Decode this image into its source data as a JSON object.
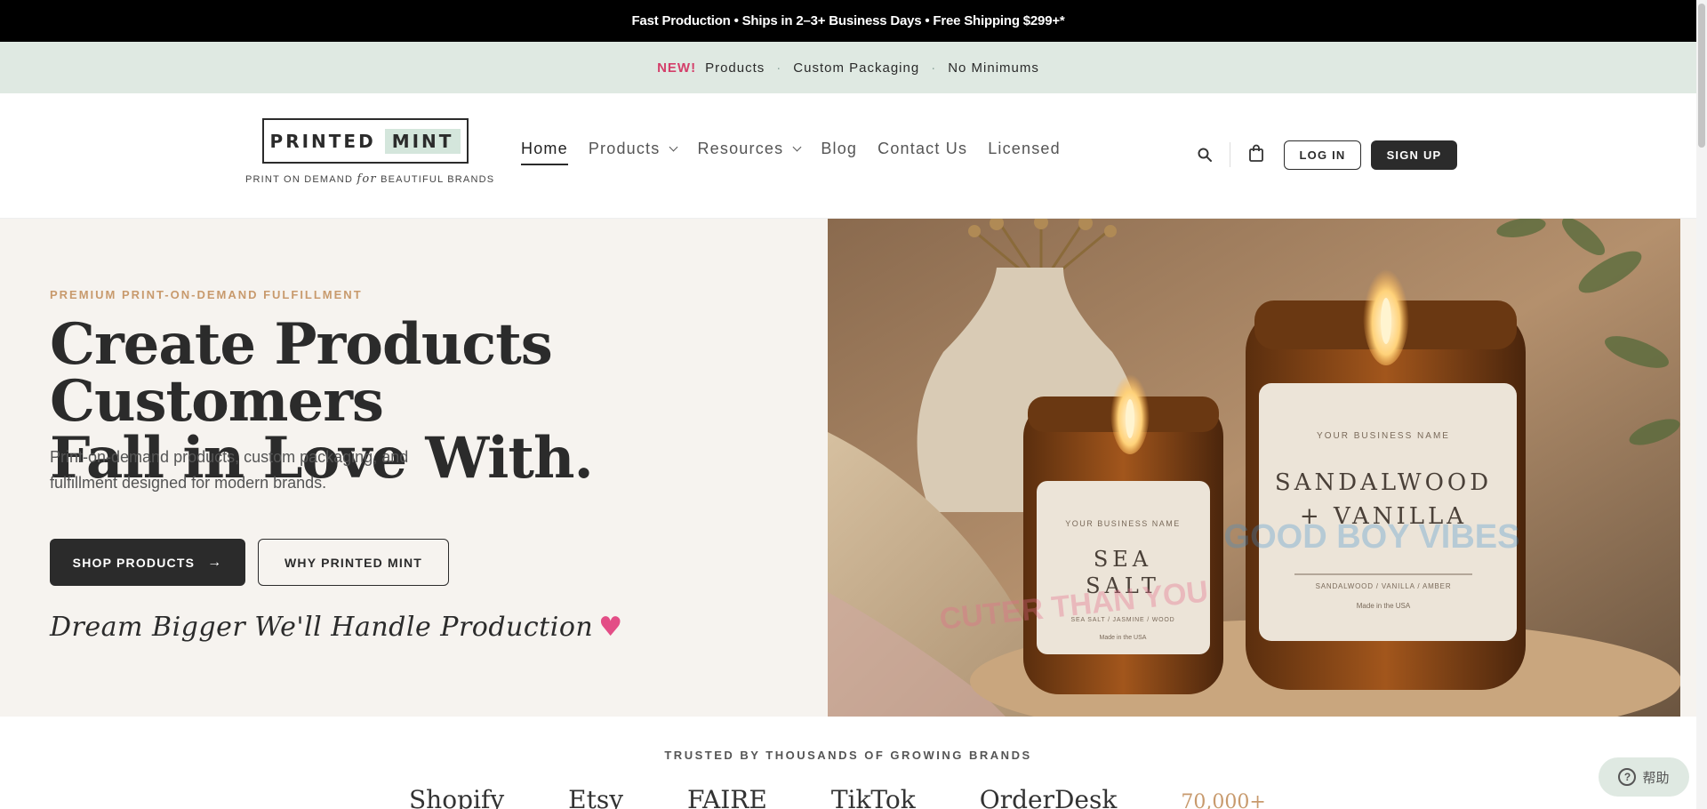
{
  "topbar": {
    "text": "Fast Production • Ships in 2–3+ Business Days • Free Shipping $299+*"
  },
  "promo": {
    "new_label": "NEW!",
    "items": [
      "Products",
      "Custom Packaging",
      "No Minimums"
    ]
  },
  "logo": {
    "word1": "PRINTED",
    "word2": "MINT",
    "tagline_left": "PRINT ON DEMAND",
    "tagline_for": "for",
    "tagline_right": "BEAUTIFUL BRANDS"
  },
  "nav": {
    "items": [
      {
        "label": "Home",
        "active": true,
        "dropdown": false
      },
      {
        "label": "Products",
        "active": false,
        "dropdown": true
      },
      {
        "label": "Resources",
        "active": false,
        "dropdown": true
      },
      {
        "label": "Blog",
        "active": false,
        "dropdown": false
      },
      {
        "label": "Contact Us",
        "active": false,
        "dropdown": false
      },
      {
        "label": "Licensed",
        "active": false,
        "dropdown": false
      }
    ]
  },
  "header_actions": {
    "search_icon": "search-icon",
    "cart_icon": "shopping-bag-icon",
    "login_label": "LOG IN",
    "signup_label": "SIGN UP"
  },
  "hero": {
    "eyebrow": "PREMIUM PRINT-ON-DEMAND FULFILLMENT",
    "headline_line1": "Create Products Customers",
    "headline_line2": "Fall in Love With.",
    "subtitle": "Print-on-demand products, custom packaging, and fulfillment designed for modern brands.",
    "primary_button": "SHOP PRODUCTS",
    "primary_arrow": "→",
    "secondary_button": "WHY PRINTED MINT",
    "script_text": "Dream Bigger We'll Handle Production",
    "heart": "♥",
    "image": {
      "small_label_brand": "YOUR BUSINESS NAME",
      "small_label_line1": "SEA",
      "small_label_line2": "SALT",
      "small_label_notes": "SEA SALT / JASMINE / WOOD",
      "small_label_made": "Made in the USA",
      "large_label_brand": "YOUR BUSINESS NAME",
      "large_label_line1": "SANDALWOOD",
      "large_label_line2": "+ VANILLA",
      "large_label_notes": "SANDALWOOD / VANILLA / AMBER",
      "large_label_made": "Made in the USA",
      "watermark1": "CUTER THAN YOU",
      "watermark2": "GOOD BOY VIBES"
    }
  },
  "trusted": {
    "heading": "TRUSTED BY THOUSANDS OF GROWING BRANDS",
    "brands": [
      "Shopify",
      "Etsy",
      "FAIRE",
      "TikTok",
      "OrderDesk"
    ],
    "count": "70,000+"
  },
  "help": {
    "label": "帮助"
  },
  "colors": {
    "topbar_bg": "#000000",
    "promo_bg": "#dfe9e2",
    "accent_pink": "#d43f6a",
    "accent_tan": "#c89a6d",
    "dark": "#2b2b2b",
    "hero_bg": "#f6f3ef"
  }
}
